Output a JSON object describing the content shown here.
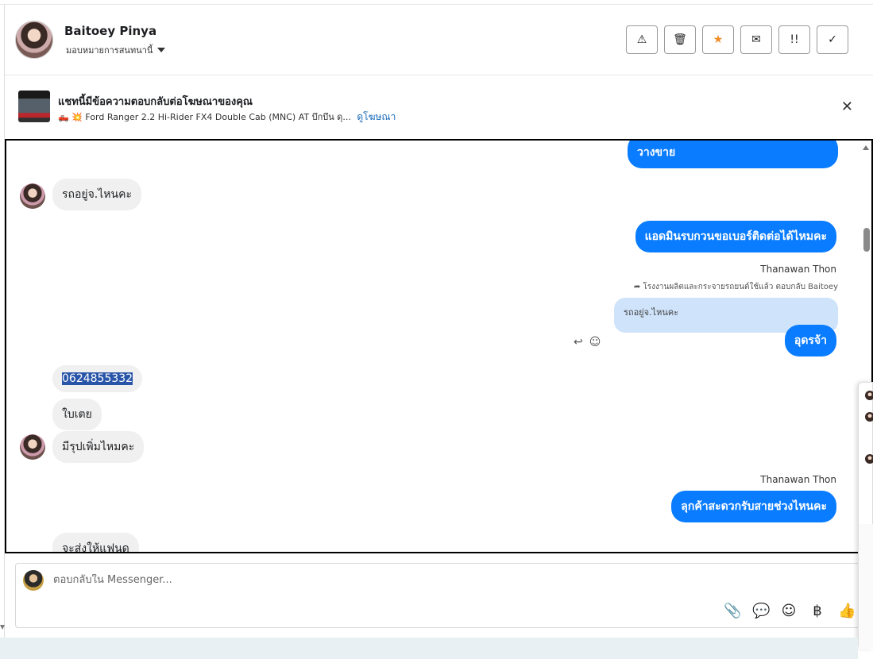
{
  "header": {
    "contact_name": "Baitoey Pinya",
    "assign_label": "มอบหมายการสนทนานี้",
    "actions": [
      {
        "icon": "warning-icon",
        "glyph": "⚠"
      },
      {
        "icon": "trash-icon",
        "glyph": "🗑"
      },
      {
        "icon": "star-icon",
        "glyph": "★"
      },
      {
        "icon": "envelope-icon",
        "glyph": "✉"
      },
      {
        "icon": "follow-up-icon",
        "glyph": "!!"
      },
      {
        "icon": "check-icon",
        "glyph": "✓"
      }
    ]
  },
  "ad": {
    "title": "แชทนี้มีข้อความตอบกลับต่อโฆษณาของคุณ",
    "subtitle": "🛻 💥 Ford Ranger 2.2 Hi-Rider FX4 Double Cab (MNC) AT บึกบึน ดุ...",
    "link": "ดูโฆษณา"
  },
  "messages": {
    "m0": "วางขาย",
    "m1": "รถอยู่จ.ไหนคะ",
    "m2": "แอดมินรบกวนขอเบอร์ติดต่อได้ไหมคะ",
    "sender_1": "Thanawan Thon",
    "reply_note": "โรงงานผลิตและกระจายรถยนต์ใช้แล้ว ตอบกลับ Baitoey",
    "quoted": "รถอยู่จ.ไหนคะ",
    "m3": "อุดรจ้า",
    "m4": "0624855332",
    "m5": "ใบเตย",
    "m6": "มีรุปเพิ่มไหมคะ",
    "sender_2": "Thanawan Thon",
    "m7": "ลุกค้าสะดวกรับสายช่วงไหนคะ",
    "m8": "จะส่งให้แฟนดู"
  },
  "composer": {
    "placeholder": "ตอบกลับใน Messenger...",
    "tools": [
      {
        "icon": "attachment-icon",
        "glyph": "📎"
      },
      {
        "icon": "saved-reply-icon",
        "glyph": "💬"
      },
      {
        "icon": "emoji-icon",
        "glyph": "☺"
      },
      {
        "icon": "baht-icon",
        "glyph": "฿"
      },
      {
        "icon": "like-icon",
        "glyph": "👍"
      }
    ]
  }
}
